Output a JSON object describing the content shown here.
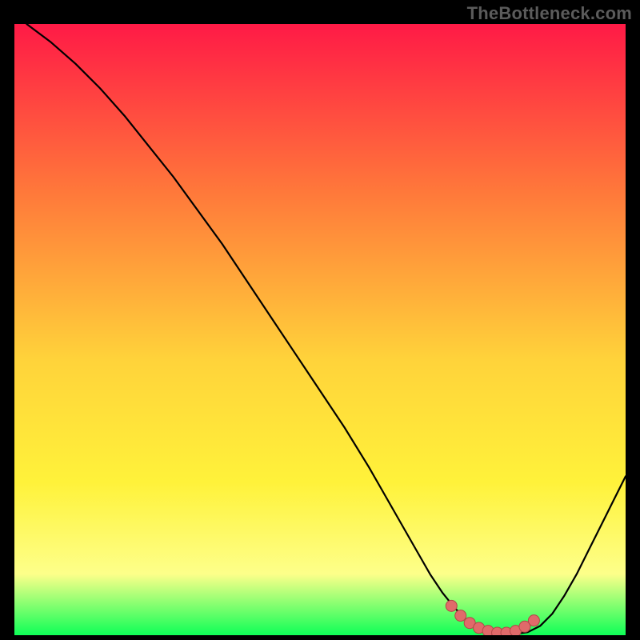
{
  "attribution": "TheBottleneck.com",
  "colors": {
    "gradient_top": "#ff1a46",
    "gradient_mid1": "#ff7a3a",
    "gradient_mid2": "#ffd33a",
    "gradient_mid3": "#fff23a",
    "gradient_mid4": "#fdff8a",
    "gradient_bottom": "#0eff57",
    "curve": "#000000",
    "marker_fill": "#e06a6a",
    "marker_stroke": "#b24747",
    "frame": "#000000"
  },
  "chart_data": {
    "type": "line",
    "title": "",
    "xlabel": "",
    "ylabel": "",
    "xlim": [
      0,
      100
    ],
    "ylim": [
      0,
      100
    ],
    "series": [
      {
        "name": "bottleneck-curve",
        "x": [
          2,
          6,
          10,
          14,
          18,
          22,
          26,
          30,
          34,
          38,
          42,
          46,
          50,
          54,
          58,
          60,
          62,
          64,
          66,
          68,
          70,
          72,
          74,
          76,
          78,
          80,
          82,
          84,
          86,
          88,
          90,
          92,
          94,
          96,
          98,
          100
        ],
        "y": [
          100,
          97,
          93.5,
          89.5,
          85,
          80,
          75,
          69.5,
          64,
          58,
          52,
          46,
          40,
          34,
          27.5,
          24,
          20.5,
          17,
          13.5,
          10,
          7,
          4.5,
          2.5,
          1.2,
          0.5,
          0.2,
          0.2,
          0.5,
          1.5,
          3.5,
          6.5,
          10,
          14,
          18,
          22,
          26
        ]
      }
    ],
    "markers": {
      "name": "optimal-range",
      "x": [
        71.5,
        73,
        74.5,
        76,
        77.5,
        79,
        80.5,
        82,
        83.5,
        85
      ],
      "y": [
        4.8,
        3.2,
        2.0,
        1.2,
        0.7,
        0.4,
        0.4,
        0.7,
        1.4,
        2.4
      ]
    }
  }
}
